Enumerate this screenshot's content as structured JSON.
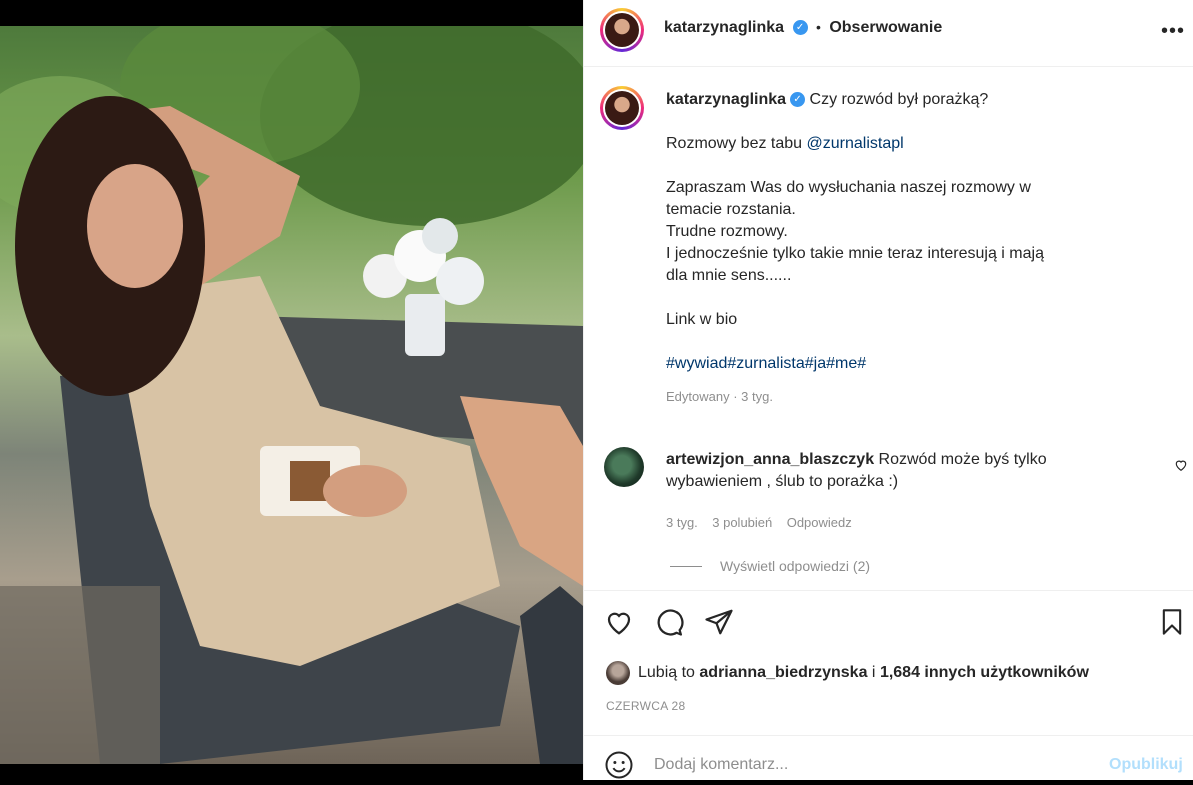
{
  "header": {
    "username": "katarzynaglinka",
    "separator": "•",
    "follow_label": "Obserwowanie",
    "more_icon": "more-options-icon"
  },
  "caption": {
    "username": "katarzynaglinka",
    "title": "Czy rozwód był porażką?",
    "line_mention_prefix": "Rozmowy bez tabu",
    "mention": "@zurnalistapl",
    "para1": "Zapraszam Was do wysłuchania naszej rozmowy w temacie rozstania.",
    "para2": "Trudne rozmowy.",
    "para3": "I jednocześnie tylko takie mnie teraz interesują i mają dla mnie sens......",
    "link_bio": "Link w bio",
    "hashtags": [
      "#wywiad",
      "#zurnalista",
      "#ja",
      "#me",
      "#"
    ],
    "edited": "Edytowany · 3 tyg."
  },
  "comment": {
    "username": "artewizjon_anna_blaszczyk",
    "text": "Rozwód może byś tylko wybawieniem , ślub to porażka :)",
    "time": "3 tyg.",
    "likes": "3 polubień",
    "reply": "Odpowiedz",
    "view_replies": "Wyświetl odpowiedzi (2)"
  },
  "likes": {
    "prefix": "Lubią to",
    "user": "adrianna_biedrzynska",
    "conj": "i",
    "others": "1,684 innych użytkowników"
  },
  "date": "CZERWCA 28",
  "add_comment": {
    "placeholder": "Dodaj komentarz...",
    "publish": "Opublikuj"
  }
}
